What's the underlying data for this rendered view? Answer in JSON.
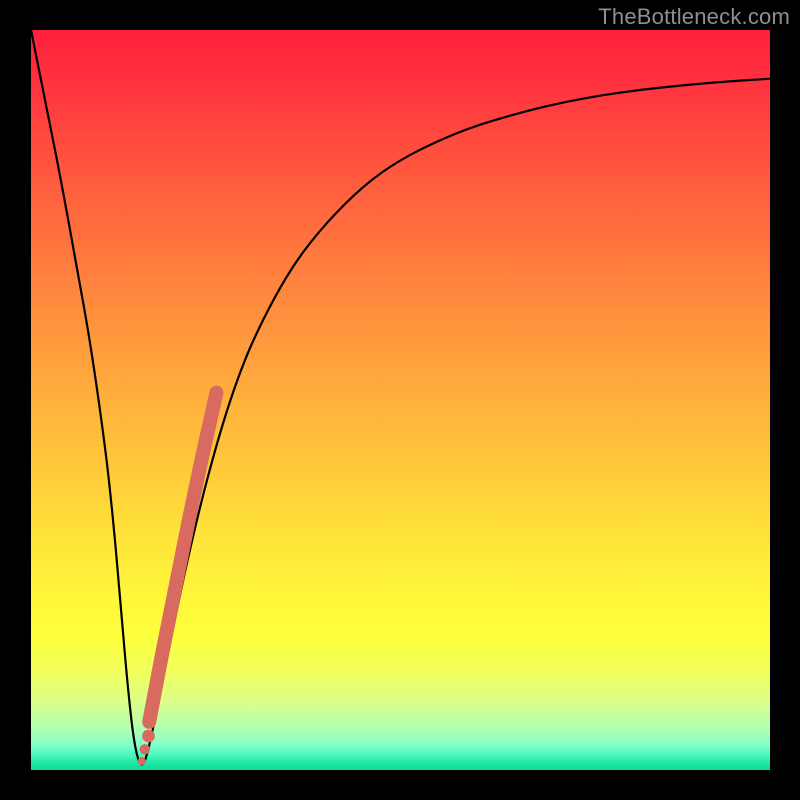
{
  "watermark": "TheBottleneck.com",
  "chart_data": {
    "type": "line",
    "title": "",
    "xlabel": "",
    "ylabel": "",
    "xlim": [
      0,
      100
    ],
    "ylim": [
      0,
      100
    ],
    "grid": false,
    "series": [
      {
        "name": "bottleneck-curve",
        "color": "#000000",
        "x": [
          0,
          2,
          4,
          6,
          8,
          10,
          11,
          12,
          13,
          14,
          15,
          16,
          18,
          20,
          22,
          24,
          26,
          28,
          30,
          33,
          36,
          40,
          45,
          50,
          55,
          60,
          65,
          70,
          75,
          80,
          85,
          90,
          95,
          100
        ],
        "y": [
          100,
          90,
          80,
          69,
          58,
          44,
          35,
          24,
          12,
          3,
          0,
          3,
          13,
          23,
          32,
          40,
          47,
          53,
          58,
          64,
          69,
          74,
          79,
          82.5,
          85,
          87,
          88.5,
          89.8,
          90.8,
          91.6,
          92.2,
          92.7,
          93.1,
          93.4
        ]
      }
    ],
    "markers": [
      {
        "name": "highlight-segment",
        "color": "#d86a60",
        "style": "thick-round",
        "x": [
          16.0,
          17.7,
          19.5,
          21.3,
          23.2,
          25.1
        ],
        "y": [
          6.5,
          15.5,
          24.5,
          33.5,
          42.5,
          51.0
        ]
      },
      {
        "name": "dot-cluster",
        "color": "#d86a60",
        "style": "dots",
        "x": [
          15.0,
          15.4,
          15.9
        ],
        "y": [
          1.2,
          2.8,
          4.6
        ]
      }
    ],
    "background_gradient": {
      "top": "#ff1f3c",
      "mid": "#ffe23a",
      "bottom": "#0bdc94"
    }
  }
}
